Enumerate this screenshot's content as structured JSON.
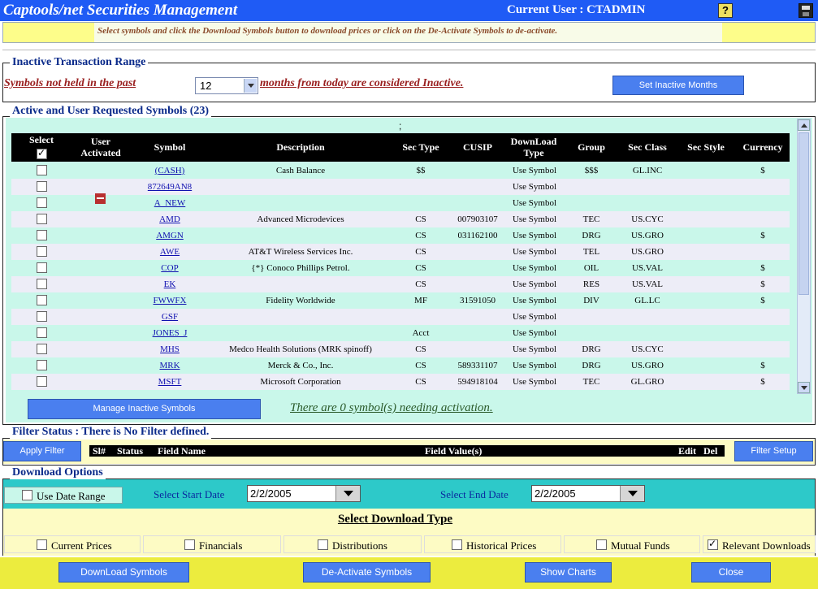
{
  "window": {
    "title": "Captools/net Securities Management",
    "current_user": "Current User : CTADMIN",
    "help_glyph": "?",
    "icons": {
      "help": "help-icon",
      "save": "save-icon"
    }
  },
  "instruction": "Select symbols and click the Download Symbols button to download prices or click on the De-Activate Symbols to de-activate.",
  "inactive_range": {
    "legend": "Inactive Transaction Range",
    "label_before": "Symbols not held in the past",
    "months": "12",
    "label_after": "months from today are considered Inactive.",
    "button": "Set Inactive Months"
  },
  "active_symbols": {
    "legend": "Active and User Requested Symbols (23)",
    "semicolon": ";",
    "columns": {
      "select": "Select",
      "user_activated": "User Activated",
      "symbol": "Symbol",
      "description": "Description",
      "sec_type": "Sec Type",
      "cusip": "CUSIP",
      "download_type": "DownLoad Type",
      "group": "Group",
      "sec_class": "Sec Class",
      "sec_style": "Sec Style",
      "currency": "Currency"
    },
    "select_all_checked": true,
    "rows": [
      {
        "symbol": "(CASH)",
        "description": "Cash Balance",
        "sec_type": "$$",
        "cusip": "",
        "dl_type": "Use Symbol",
        "group": "$$$",
        "sec_class": "GL.INC",
        "sec_style": "",
        "currency": "$",
        "user_activated": false
      },
      {
        "symbol": "872649AN8",
        "description": "",
        "sec_type": "",
        "cusip": "",
        "dl_type": "Use Symbol",
        "group": "",
        "sec_class": "",
        "sec_style": "",
        "currency": "",
        "user_activated": false
      },
      {
        "symbol": "A_NEW",
        "description": "",
        "sec_type": "",
        "cusip": "",
        "dl_type": "Use Symbol",
        "group": "",
        "sec_class": "",
        "sec_style": "",
        "currency": "",
        "user_activated": true
      },
      {
        "symbol": "AMD",
        "description": "Advanced Microdevices",
        "sec_type": "CS",
        "cusip": "007903107",
        "dl_type": "Use Symbol",
        "group": "TEC",
        "sec_class": "US.CYC",
        "sec_style": "",
        "currency": "",
        "user_activated": false
      },
      {
        "symbol": "AMGN",
        "description": "",
        "sec_type": "CS",
        "cusip": "031162100",
        "dl_type": "Use Symbol",
        "group": "DRG",
        "sec_class": "US.GRO",
        "sec_style": "",
        "currency": "$",
        "user_activated": false
      },
      {
        "symbol": "AWE",
        "description": "AT&T Wireless Services Inc.",
        "sec_type": "CS",
        "cusip": "",
        "dl_type": "Use Symbol",
        "group": "TEL",
        "sec_class": "US.GRO",
        "sec_style": "",
        "currency": "",
        "user_activated": false
      },
      {
        "symbol": "COP",
        "description": "{*} Conoco Phillips Petrol.",
        "sec_type": "CS",
        "cusip": "",
        "dl_type": "Use Symbol",
        "group": "OIL",
        "sec_class": "US.VAL",
        "sec_style": "",
        "currency": "$",
        "user_activated": false
      },
      {
        "symbol": "EK",
        "description": "",
        "sec_type": "CS",
        "cusip": "",
        "dl_type": "Use Symbol",
        "group": "RES",
        "sec_class": "US.VAL",
        "sec_style": "",
        "currency": "$",
        "user_activated": false
      },
      {
        "symbol": "FWWFX",
        "description": "Fidelity Worldwide",
        "sec_type": "MF",
        "cusip": "31591050",
        "dl_type": "Use Symbol",
        "group": "DIV",
        "sec_class": "GL.LC",
        "sec_style": "",
        "currency": "$",
        "user_activated": false
      },
      {
        "symbol": "GSF",
        "description": "",
        "sec_type": "",
        "cusip": "",
        "dl_type": "Use Symbol",
        "group": "",
        "sec_class": "",
        "sec_style": "",
        "currency": "",
        "user_activated": false
      },
      {
        "symbol": "JONES_J",
        "description": "",
        "sec_type": "Acct",
        "cusip": "",
        "dl_type": "Use Symbol",
        "group": "",
        "sec_class": "",
        "sec_style": "",
        "currency": "",
        "user_activated": false
      },
      {
        "symbol": "MHS",
        "description": "Medco Health Solutions (MRK spinoff)",
        "sec_type": "CS",
        "cusip": "",
        "dl_type": "Use Symbol",
        "group": "DRG",
        "sec_class": "US.CYC",
        "sec_style": "",
        "currency": "",
        "user_activated": false
      },
      {
        "symbol": "MRK",
        "description": "Merck & Co., Inc.",
        "sec_type": "CS",
        "cusip": "589331107",
        "dl_type": "Use Symbol",
        "group": "DRG",
        "sec_class": "US.GRO",
        "sec_style": "",
        "currency": "$",
        "user_activated": false
      },
      {
        "symbol": "MSFT",
        "description": "Microsoft Corporation",
        "sec_type": "CS",
        "cusip": "594918104",
        "dl_type": "Use Symbol",
        "group": "TEC",
        "sec_class": "GL.GRO",
        "sec_style": "",
        "currency": "$",
        "user_activated": false
      }
    ],
    "manage_button": "Manage Inactive Symbols",
    "activation_message": "There are 0 symbol(s) needing activation."
  },
  "filter": {
    "legend": "Filter Status : There is No Filter defined.",
    "apply_button": "Apply Filter",
    "setup_button": "Filter Setup",
    "columns": {
      "sl": "Sl#",
      "status": "Status",
      "field_name": "Field Name",
      "field_values": "Field Value(s)",
      "edit": "Edit",
      "del": "Del"
    }
  },
  "download": {
    "legend": "Download Options",
    "use_date_range": "Use Date Range",
    "use_date_range_checked": false,
    "start_label": "Select Start Date",
    "start_date": "2/2/2005",
    "end_label": "Select End Date",
    "end_date": "2/2/2005",
    "type_title": "Select Download Type",
    "types": [
      {
        "label": "Current Prices",
        "checked": false
      },
      {
        "label": "Financials",
        "checked": false
      },
      {
        "label": "Distributions",
        "checked": false
      },
      {
        "label": "Historical Prices",
        "checked": false
      },
      {
        "label": "Mutual Funds",
        "checked": false
      },
      {
        "label": "Relevant Downloads",
        "checked": true
      }
    ]
  },
  "actions": {
    "download": "DownLoad Symbols",
    "deactivate": "De-Activate Symbols",
    "charts": "Show Charts",
    "close": "Close"
  },
  "colors": {
    "title_bar": "#1f5bf5",
    "grid_odd": "#c9f7ea",
    "grid_even": "#ededf7",
    "button": "#4a7fef",
    "bottom_bar": "#ecec3e",
    "link": "#1010b0"
  }
}
